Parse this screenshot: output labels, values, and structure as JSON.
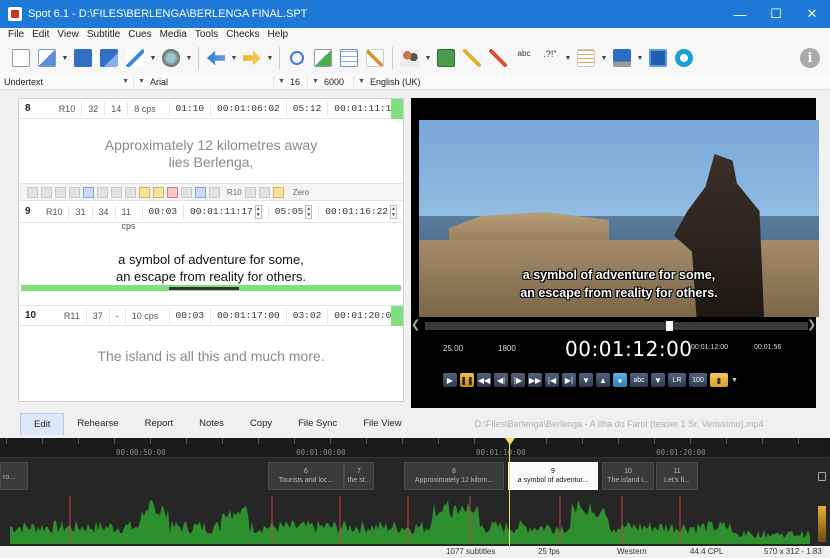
{
  "window": {
    "title": "Spot 6.1 - D:\\FILES\\BERLENGA\\BERLENGA FINAL.SPT"
  },
  "menu": [
    "File",
    "Edit",
    "View",
    "Subtitle",
    "Cues",
    "Media",
    "Tools",
    "Checks",
    "Help"
  ],
  "format": {
    "style": "Undertext",
    "font": "Arial",
    "size": "16",
    "duration": "6000",
    "language": "English (UK)"
  },
  "subtitles": [
    {
      "number": "8",
      "reading": "R10",
      "chars": "32",
      "col3": "14",
      "cps": "8 cps",
      "duration": "01:10",
      "in": "00:01:06:02",
      "gap": "05:12",
      "out": "00:01:11:14",
      "line1": "Approximately 12 kilometres away",
      "line2": "lies Berlenga,"
    },
    {
      "number": "9",
      "reading": "R10",
      "chars": "31",
      "col3": "34",
      "cps": "11 cps",
      "duration": "00:03",
      "in": "00:01:11:17",
      "gap": "05:05",
      "out": "00:01:16:22",
      "line1": "a symbol of adventure for some,",
      "line2": "an escape from reality for others."
    },
    {
      "number": "10",
      "reading": "R11",
      "chars": "37",
      "col3": "-",
      "cps": "10 cps",
      "duration": "00:03",
      "in": "00:01:17:00",
      "gap": "03:02",
      "out": "00:01:20:02",
      "line1": "The island is all this and much more.",
      "line2": ""
    }
  ],
  "editbar": {
    "r10": "R10",
    "zero": "Zero"
  },
  "video": {
    "subtitle_line1": "a symbol of adventure for some,",
    "subtitle_line2": "an escape from reality for others.",
    "fps": "25.00",
    "frames": "1800",
    "timecode": "00:01:12:00",
    "small_time1": "00:01:12:00",
    "small_time2": "00:01:56",
    "seek_progress": 0.63,
    "lr_label": "LR",
    "volume_label": "100",
    "abc_label": "abc"
  },
  "tabs": [
    "Edit",
    "Rehearse",
    "Report",
    "Notes",
    "Copy",
    "File Sync",
    "File View"
  ],
  "media_path": "D:\\Files\\Berlenga\\Berlenga - A Ilha do Farol (teaser 1 Sr. Verissimo).mp4",
  "timeline": {
    "ruler_labels": [
      "00:00:50:00",
      "00:01:00:00",
      "00:01:10:00",
      "00:01:20:00"
    ],
    "blocks": [
      {
        "num": "",
        "text": "ro..."
      },
      {
        "num": "6",
        "text": "Tourists and loc..."
      },
      {
        "num": "7",
        "text": "the st..."
      },
      {
        "num": "8",
        "text": "Approximately 12 kilom..."
      },
      {
        "num": "9",
        "text": "a symbol of adventur..."
      },
      {
        "num": "10",
        "text": "The island i..."
      },
      {
        "num": "11",
        "text": "Let's fi..."
      }
    ]
  },
  "status": {
    "count": "1077 subtitles",
    "fps": "25 fps",
    "encoding": "Western",
    "cpl": "44.4 CPL",
    "resolution": "570 x 312 - 1.83"
  }
}
